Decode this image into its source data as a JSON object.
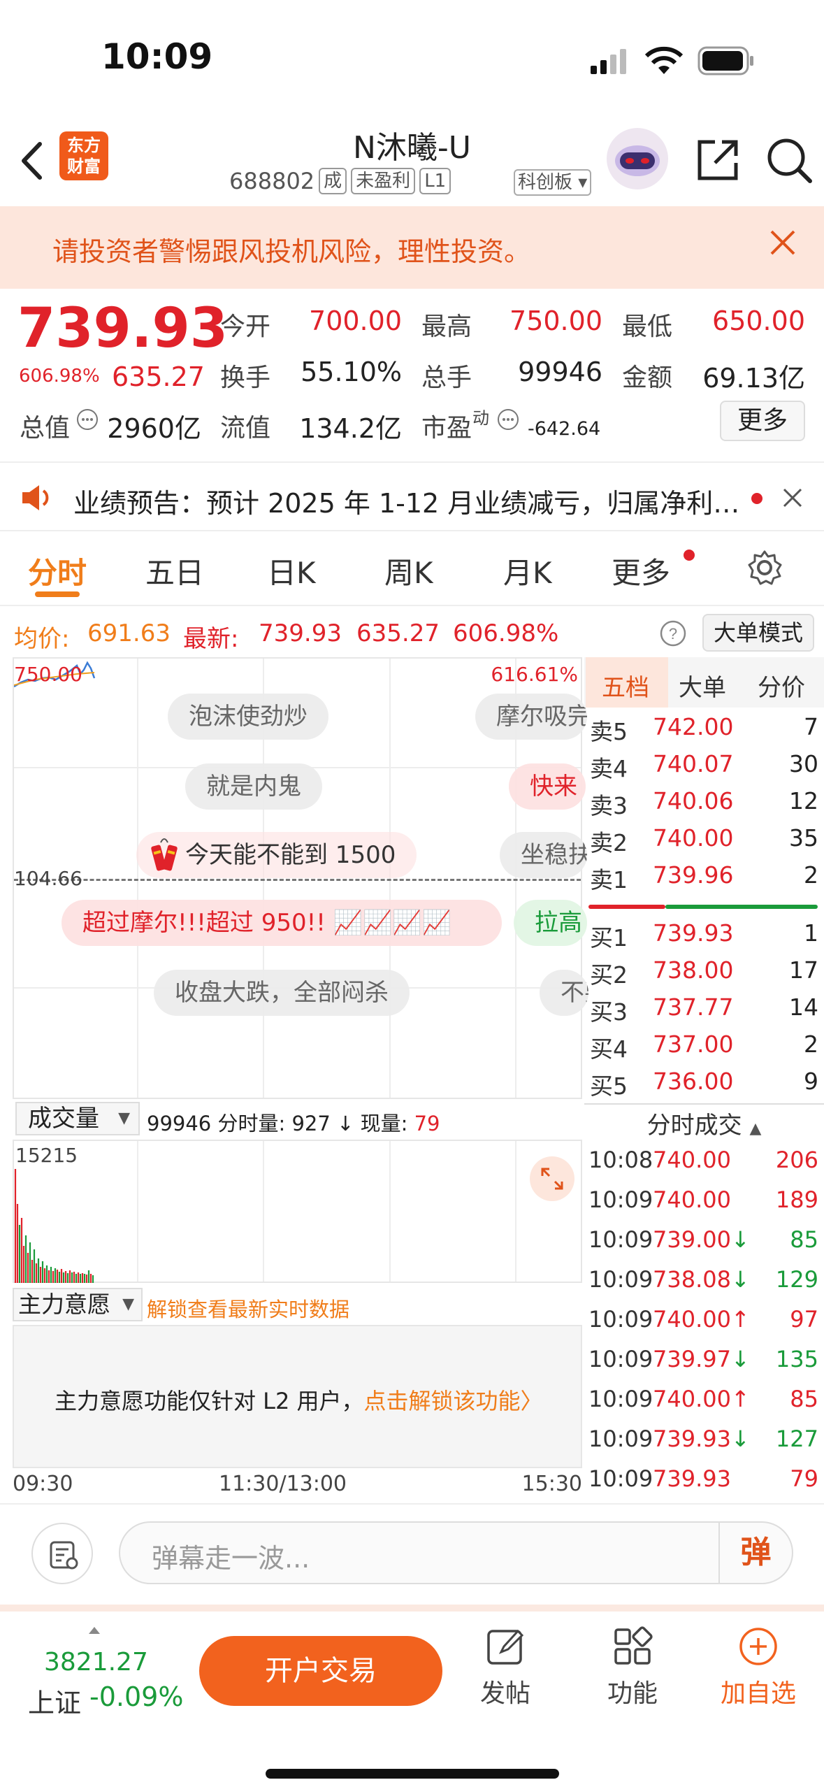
{
  "status_bar": {
    "time": "10:09"
  },
  "nav": {
    "logo_text_line1": "东方",
    "logo_text_line2": "财富",
    "stock_name": "N沐曦-U",
    "stock_code": "688802",
    "tags": [
      "成",
      "未盈利",
      "L1"
    ],
    "board": "科创板"
  },
  "warning": {
    "text": "请投资者警惕跟风投机风险，理性投资。"
  },
  "quote": {
    "price": "739.93",
    "change_pct": "606.98%",
    "change": "635.27",
    "open_label": "今开",
    "open": "700.00",
    "high_label": "最高",
    "high": "750.00",
    "low_label": "最低",
    "low": "650.00",
    "turnover_label": "换手",
    "turnover": "55.10%",
    "volume_label": "总手",
    "volume": "99946",
    "amount_label": "金额",
    "amount": "69.13亿",
    "mktcap_label": "总值",
    "mktcap": "2960亿",
    "float_label": "流值",
    "float": "134.2亿",
    "pe_label": "市盈",
    "pe_sup": "动",
    "pe": "-642.64",
    "more_label": "更多"
  },
  "notice": {
    "text": "业绩预告：预计 2025 年 1-12 月业绩减亏，归属净利…"
  },
  "tabs": [
    "分时",
    "五日",
    "日K",
    "周K",
    "月K",
    "更多"
  ],
  "avg_row": {
    "avg_label": "均价:",
    "avg": "691.63",
    "latest_label": "最新:",
    "latest": "739.93",
    "change": "635.27",
    "pct": "606.98%",
    "bigorder_mode": "大单模式"
  },
  "chart": {
    "top_left": "750.00",
    "top_right": "616.61%",
    "mid_label": "104.66",
    "danmu": [
      "泡沫使劲炒",
      "摩尔吸完",
      "就是内鬼",
      "快来",
      "今天能不能到 1500",
      "坐稳扶",
      "超过摩尔!!!超过 950!!",
      "拉高",
      "收盘大跌，全部闷杀",
      "不要"
    ]
  },
  "volume": {
    "select_label": "成交量",
    "total": "99946",
    "period_label": "分时量:",
    "period": "927",
    "arrow": "↓",
    "now_label": "现量:",
    "now": "79",
    "max": "15215"
  },
  "force": {
    "select_label": "主力意愿",
    "unlock": "解锁查看最新实时数据",
    "msg": "主力意愿功能仅针对 L2 用户，",
    "msg_link": "点击解锁该功能〉"
  },
  "time_axis": [
    "09:30",
    "11:30/13:00",
    "15:30"
  ],
  "book": {
    "tabs": [
      "五档",
      "大单",
      "分价"
    ],
    "asks": [
      {
        "label": "卖5",
        "price": "742.00",
        "vol": "7"
      },
      {
        "label": "卖4",
        "price": "740.07",
        "vol": "30"
      },
      {
        "label": "卖3",
        "price": "740.06",
        "vol": "12"
      },
      {
        "label": "卖2",
        "price": "740.00",
        "vol": "35"
      },
      {
        "label": "卖1",
        "price": "739.96",
        "vol": "2"
      }
    ],
    "bids": [
      {
        "label": "买1",
        "price": "739.93",
        "vol": "1"
      },
      {
        "label": "买2",
        "price": "738.00",
        "vol": "17"
      },
      {
        "label": "买3",
        "price": "737.77",
        "vol": "14"
      },
      {
        "label": "买4",
        "price": "737.00",
        "vol": "2"
      },
      {
        "label": "买5",
        "price": "736.00",
        "vol": "9"
      }
    ],
    "ticks_title": "分时成交",
    "ticks": [
      {
        "time": "10:08",
        "price": "740.00",
        "vol": "206",
        "dir": "",
        "color": "red"
      },
      {
        "time": "10:09",
        "price": "740.00",
        "vol": "189",
        "dir": "",
        "color": "red"
      },
      {
        "time": "10:09",
        "price": "739.00",
        "vol": "85",
        "dir": "↓",
        "color": "green"
      },
      {
        "time": "10:09",
        "price": "738.08",
        "vol": "129",
        "dir": "↓",
        "color": "green"
      },
      {
        "time": "10:09",
        "price": "740.00",
        "vol": "97",
        "dir": "↑",
        "color": "red"
      },
      {
        "time": "10:09",
        "price": "739.97",
        "vol": "135",
        "dir": "↓",
        "color": "green"
      },
      {
        "time": "10:09",
        "price": "740.00",
        "vol": "85",
        "dir": "↑",
        "color": "red"
      },
      {
        "time": "10:09",
        "price": "739.93",
        "vol": "127",
        "dir": "↓",
        "color": "green"
      },
      {
        "time": "10:09",
        "price": "739.93",
        "vol": "79",
        "dir": "",
        "color": "red"
      }
    ]
  },
  "comment": {
    "placeholder": "弹幕走一波...",
    "danmu_button": "弹"
  },
  "bottom_bar": {
    "index_value": "3821.27",
    "index_name": "上证",
    "index_change": "-0.09%",
    "open_account": "开户交易",
    "items": [
      "发帖",
      "功能",
      "加自选"
    ]
  },
  "colors": {
    "red": "#e0222a",
    "green": "#1a9b3a",
    "orange": "#f07d1a",
    "accent": "#f2621e"
  }
}
